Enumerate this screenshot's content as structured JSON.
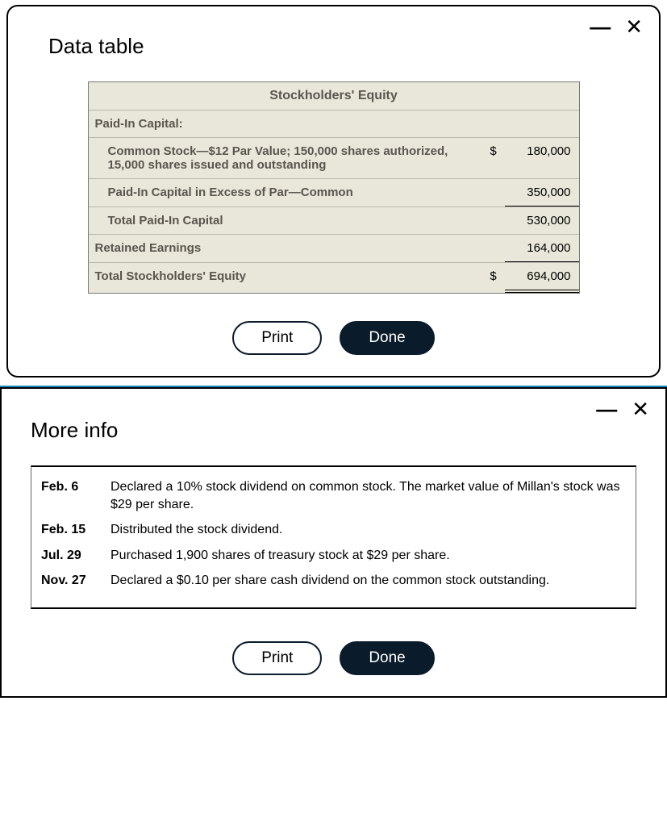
{
  "modal1": {
    "title": "Data table",
    "controls": {
      "minimize": "—",
      "close": "✕"
    },
    "buttons": {
      "print": "Print",
      "done": "Done"
    },
    "equity": {
      "header": "Stockholders' Equity",
      "paidInCapitalLabel": "Paid-In Capital:",
      "rows": [
        {
          "label": "Common Stock—$12 Par Value; 150,000 shares authorized, 15,000 shares issued and outstanding",
          "dollar": "$",
          "value": "180,000"
        },
        {
          "label": "Paid-In Capital in Excess of Par—Common",
          "dollar": "",
          "value": "350,000"
        },
        {
          "label": "Total Paid-In Capital",
          "dollar": "",
          "value": "530,000"
        },
        {
          "label": "Retained Earnings",
          "dollar": "",
          "value": "164,000"
        },
        {
          "label": "Total Stockholders' Equity",
          "dollar": "$",
          "value": "694,000"
        }
      ]
    }
  },
  "modal2": {
    "title": "More info",
    "controls": {
      "minimize": "—",
      "close": "✕"
    },
    "buttons": {
      "print": "Print",
      "done": "Done"
    },
    "events": [
      {
        "date": "Feb. 6",
        "desc": "Declared a 10% stock dividend on common stock. The market value of Millan's stock was $29 per share."
      },
      {
        "date": "Feb. 15",
        "desc": "Distributed the stock dividend."
      },
      {
        "date": "Jul. 29",
        "desc": "Purchased 1,900 shares of treasury stock at $29 per share."
      },
      {
        "date": "Nov. 27",
        "desc": "Declared a $0.10 per share cash dividend on the common stock outstanding."
      }
    ]
  }
}
